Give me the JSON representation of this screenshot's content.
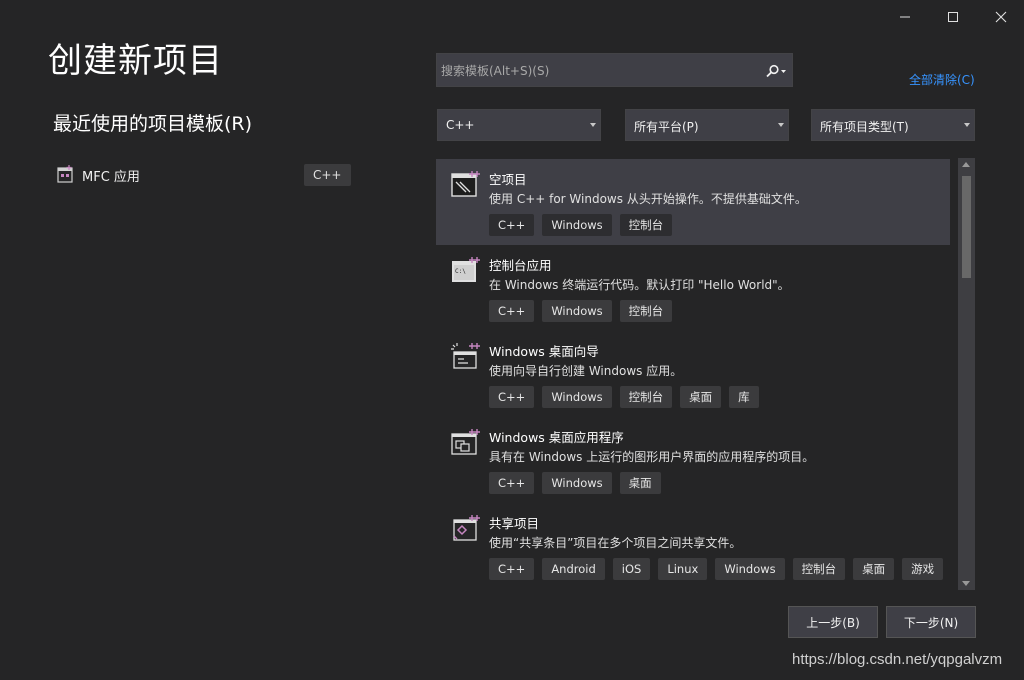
{
  "window": {
    "minimize_icon": "minimize-icon",
    "maximize_icon": "maximize-icon",
    "close_icon": "close-icon"
  },
  "page_title": "创建新项目",
  "recent": {
    "header": "最近使用的项目模板(R)",
    "items": [
      {
        "icon": "mfc-app-icon",
        "label": "MFC 应用",
        "tag": "C++"
      }
    ]
  },
  "search": {
    "placeholder": "搜索模板(Alt+S)(S)",
    "value": "",
    "icon": "search-icon"
  },
  "clear_all_label": "全部清除(C)",
  "filters": {
    "language": "C++",
    "platform": "所有平台(P)",
    "project_type": "所有项目类型(T)"
  },
  "templates": [
    {
      "name": "空项目",
      "description": "使用 C++ for Windows 从头开始操作。不提供基础文件。",
      "tags": [
        "C++",
        "Windows",
        "控制台"
      ],
      "icon": "empty-project-icon",
      "selected": true
    },
    {
      "name": "控制台应用",
      "description": "在 Windows 终端运行代码。默认打印 \"Hello World\"。",
      "tags": [
        "C++",
        "Windows",
        "控制台"
      ],
      "icon": "console-app-icon",
      "selected": false
    },
    {
      "name": "Windows 桌面向导",
      "description": "使用向导自行创建 Windows 应用。",
      "tags": [
        "C++",
        "Windows",
        "控制台",
        "桌面",
        "库"
      ],
      "icon": "desktop-wizard-icon",
      "selected": false
    },
    {
      "name": "Windows 桌面应用程序",
      "description": "具有在 Windows 上运行的图形用户界面的应用程序的项目。",
      "tags": [
        "C++",
        "Windows",
        "桌面"
      ],
      "icon": "desktop-app-icon",
      "selected": false
    },
    {
      "name": "共享项目",
      "description": "使用“共享条目”项目在多个项目之间共享文件。",
      "tags": [
        "C++",
        "Android",
        "iOS",
        "Linux",
        "Windows",
        "控制台",
        "桌面",
        "游戏"
      ],
      "icon": "shared-project-icon",
      "selected": false
    }
  ],
  "buttons": {
    "back": "上一步(B)",
    "next": "下一步(N)"
  },
  "watermark": "https://blog.csdn.net/yqpgalvzm",
  "colors": {
    "background": "#252526",
    "panel": "#3f3f46",
    "tag": "#3b3b3d",
    "link": "#3794ff",
    "text": "#f1f1f1"
  }
}
